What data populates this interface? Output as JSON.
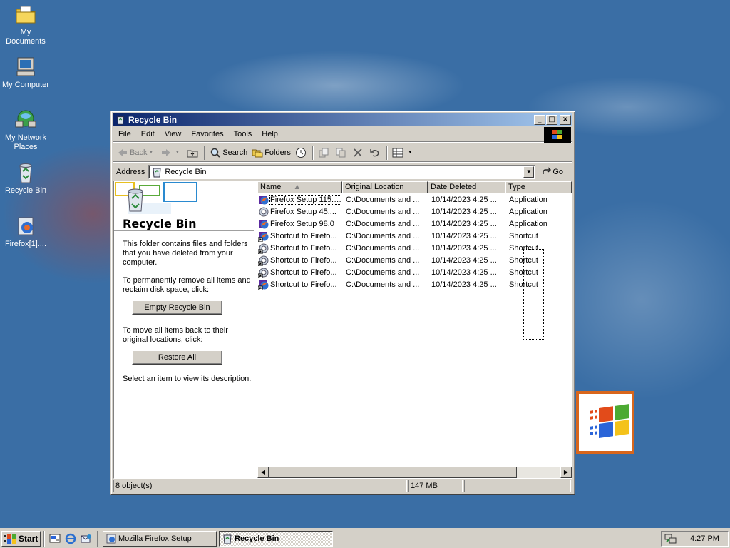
{
  "desktop": {
    "icons": [
      {
        "label": "My Documents",
        "icon": "folder-documents-icon"
      },
      {
        "label": "My Computer",
        "icon": "computer-icon"
      },
      {
        "label": "My Network Places",
        "icon": "network-icon"
      },
      {
        "label": "Recycle Bin",
        "icon": "recycle-bin-icon"
      },
      {
        "label": "Firefox[1]....",
        "icon": "firefox-installer-icon"
      }
    ]
  },
  "window": {
    "title": "Recycle Bin",
    "menu": [
      "File",
      "Edit",
      "View",
      "Favorites",
      "Tools",
      "Help"
    ],
    "toolbar": {
      "back": "Back",
      "search": "Search",
      "folders": "Folders"
    },
    "address": {
      "label": "Address",
      "value": "Recycle Bin",
      "go": "Go"
    },
    "left_pane": {
      "title": "Recycle Bin",
      "description": "This folder contains files and folders that you have deleted from your computer.",
      "empty_prompt": "To permanently remove all items and reclaim disk space, click:",
      "empty_button": "Empty Recycle Bin",
      "restore_prompt": "To move all items back to their original locations, click:",
      "restore_button": "Restore All",
      "hint": "Select an item to view its description."
    },
    "columns": [
      "Name",
      "Original Location",
      "Date Deleted",
      "Type"
    ],
    "rows": [
      {
        "name": "Firefox Setup 115.0...",
        "location": "C:\\Documents and ...",
        "date": "10/14/2023 4:25 ...",
        "type": "Application",
        "icon": "firefox-setup-icon"
      },
      {
        "name": "Firefox Setup 45....",
        "location": "C:\\Documents and ...",
        "date": "10/14/2023 4:25 ...",
        "type": "Application",
        "icon": "firefox-old-icon"
      },
      {
        "name": "Firefox Setup 98.0",
        "location": "C:\\Documents and ...",
        "date": "10/14/2023 4:25 ...",
        "type": "Application",
        "icon": "firefox-setup-icon"
      },
      {
        "name": "Shortcut to Firefo...",
        "location": "C:\\Documents and ...",
        "date": "10/14/2023 4:25 ...",
        "type": "Shortcut",
        "icon": "shortcut-icon"
      },
      {
        "name": "Shortcut to Firefo...",
        "location": "C:\\Documents and ...",
        "date": "10/14/2023 4:25 ...",
        "type": "Shortcut",
        "icon": "shortcut-old-icon"
      },
      {
        "name": "Shortcut to Firefo...",
        "location": "C:\\Documents and ...",
        "date": "10/14/2023 4:25 ...",
        "type": "Shortcut",
        "icon": "shortcut-old-icon"
      },
      {
        "name": "Shortcut to Firefo...",
        "location": "C:\\Documents and ...",
        "date": "10/14/2023 4:25 ...",
        "type": "Shortcut",
        "icon": "shortcut-old-icon"
      },
      {
        "name": "Shortcut to Firefo...",
        "location": "C:\\Documents and ...",
        "date": "10/14/2023 4:25 ...",
        "type": "Shortcut",
        "icon": "shortcut-icon"
      }
    ],
    "status": {
      "count": "8 object(s)",
      "size": "147 MB"
    }
  },
  "taskbar": {
    "start": "Start",
    "tasks": [
      "Mozilla Firefox Setup",
      "Recycle Bin"
    ],
    "clock": "4:27 PM"
  },
  "colors": {
    "desktop": "#3a6ea5",
    "title_start": "#0a246a",
    "title_end": "#a6caf0",
    "face": "#d4d0c8"
  }
}
